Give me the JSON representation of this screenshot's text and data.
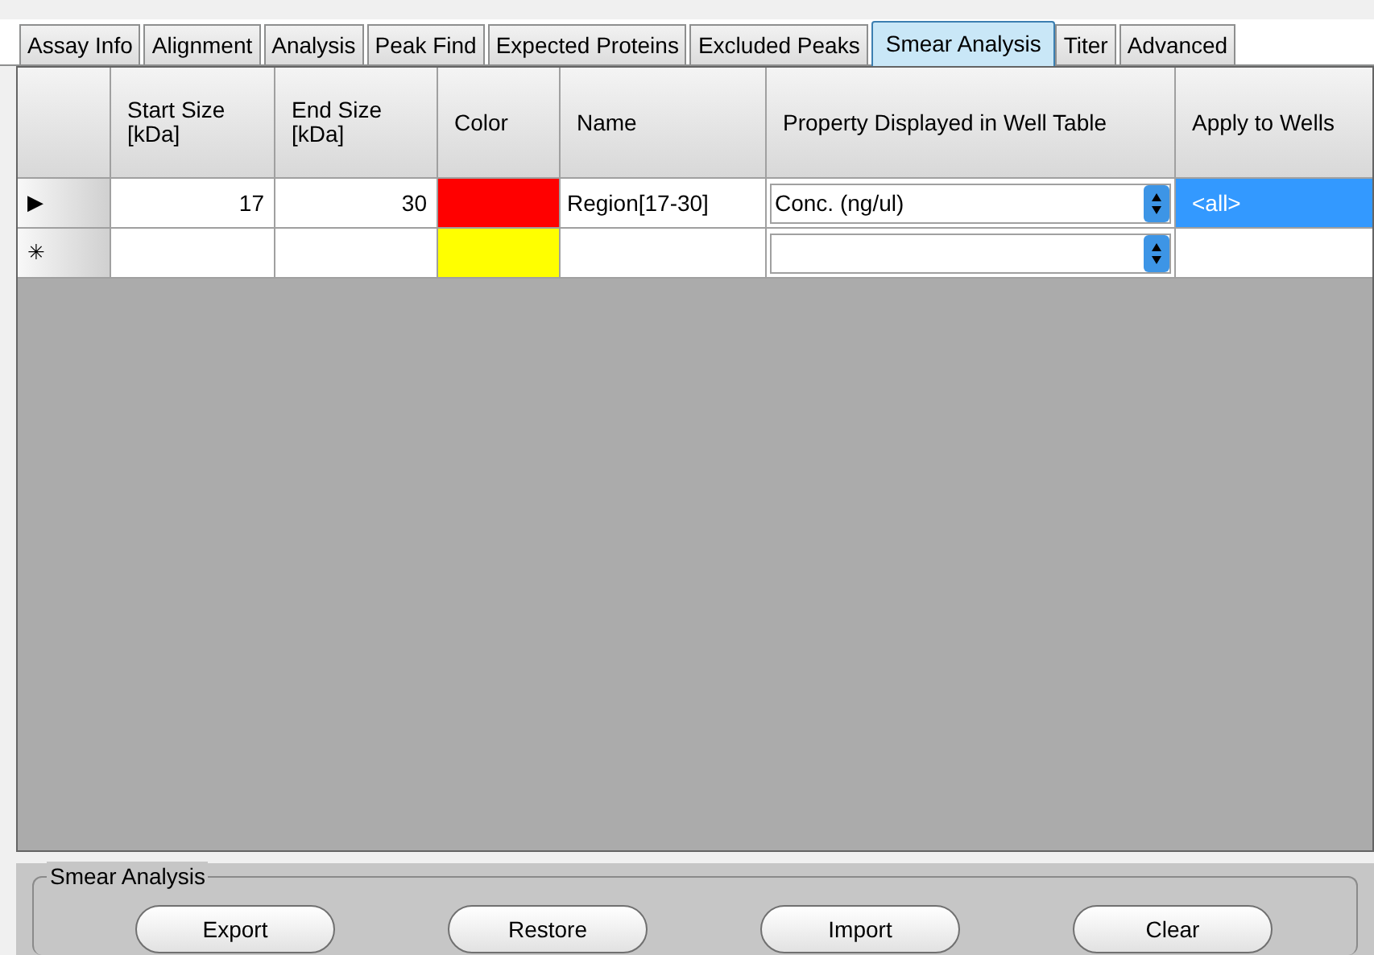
{
  "tabs": [
    {
      "label": "Assay Info",
      "selected": false
    },
    {
      "label": "Alignment",
      "selected": false
    },
    {
      "label": "Analysis",
      "selected": false
    },
    {
      "label": "Peak Find",
      "selected": false
    },
    {
      "label": "Expected Proteins",
      "selected": false
    },
    {
      "label": "Excluded Peaks",
      "selected": false
    },
    {
      "label": "Smear Analysis",
      "selected": true
    },
    {
      "label": "Titer",
      "selected": false
    },
    {
      "label": "Advanced",
      "selected": false
    }
  ],
  "table": {
    "columns": [
      "Start Size [kDa]",
      "End Size [kDa]",
      "Color",
      "Name",
      "Property Displayed in Well Table",
      "Apply to Wells"
    ],
    "rows": [
      {
        "marker": "▶",
        "start": "17",
        "end": "30",
        "color": "#ff0000",
        "name": "Region[17-30]",
        "property": "Conc. (ng/ul)",
        "apply": "<all>",
        "apply_selected": true
      },
      {
        "marker": "✳",
        "start": "",
        "end": "",
        "color": "#ffff00",
        "name": "",
        "property": "",
        "apply": "",
        "apply_selected": false
      }
    ]
  },
  "group": {
    "title": "Smear Analysis",
    "buttons": [
      "Export",
      "Restore",
      "Import",
      "Clear"
    ]
  }
}
